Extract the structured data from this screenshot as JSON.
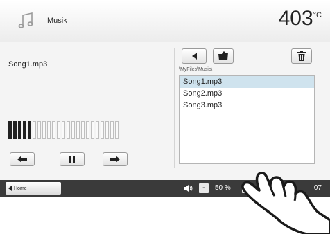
{
  "header": {
    "title": "Musik",
    "temperature": "403",
    "temperature_unit": "°C",
    "icon": "music-note-icon"
  },
  "player": {
    "song_name": "Song1.mp3",
    "volume_level_bars": 5,
    "volume_total_bars": 23,
    "buttons": [
      "previous-icon",
      "pause-icon",
      "next-icon"
    ]
  },
  "browser": {
    "buttons": [
      "back-icon",
      "open-folder-icon",
      "delete-icon"
    ],
    "path": "\\MyFiles\\Music\\",
    "files": [
      {
        "name": "Song1.mp3",
        "selected": true
      },
      {
        "name": "Song2.mp3",
        "selected": false
      },
      {
        "name": "Song3.mp3",
        "selected": false
      }
    ]
  },
  "statusbar": {
    "home_label": "Home",
    "volume_minus": "-",
    "volume_percent": "50 %",
    "volume_plus": "+",
    "time": ":07"
  },
  "colors": {
    "statusbar_bg": "#3a3a3a",
    "selection": "#cfe3ee",
    "header_bg": "#ececec"
  }
}
